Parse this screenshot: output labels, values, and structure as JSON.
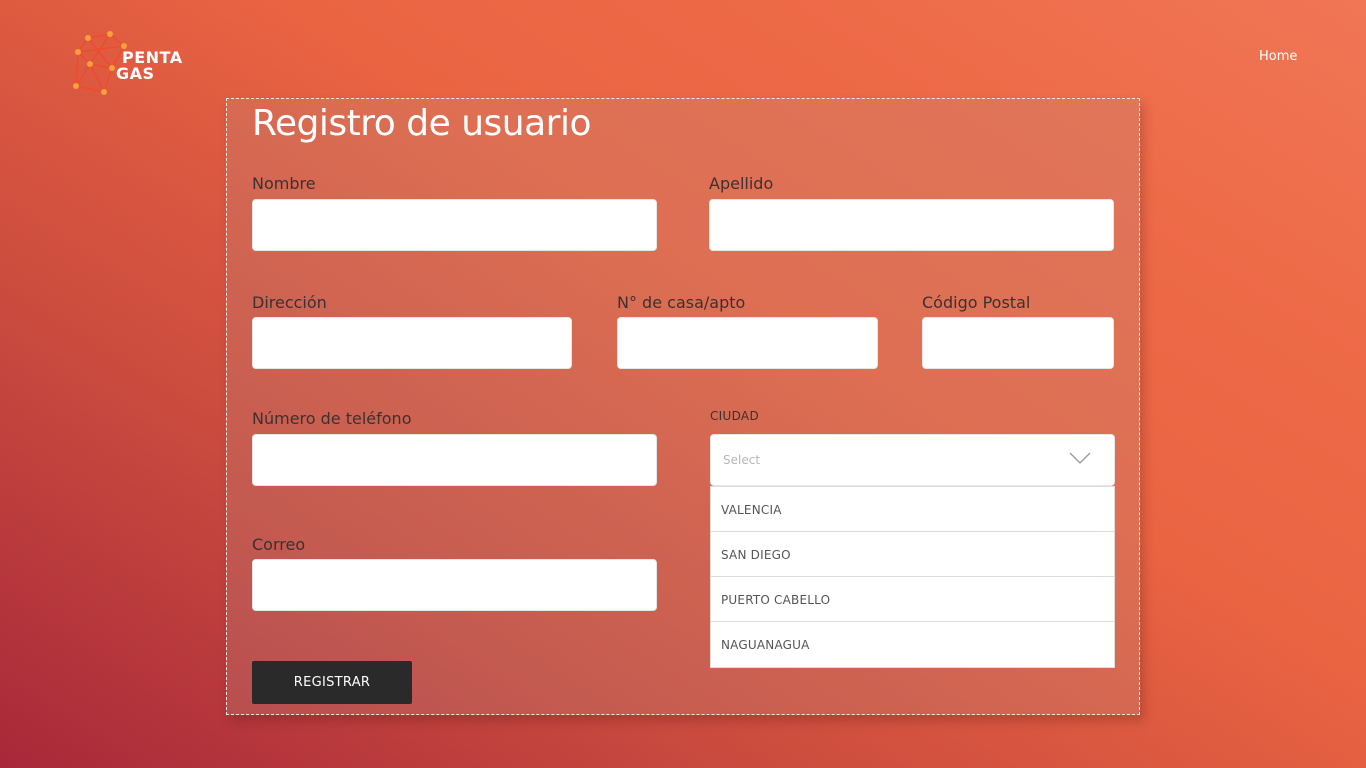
{
  "brand": {
    "line1": "PENTA",
    "line2": "GAS"
  },
  "nav": {
    "home": "Home"
  },
  "form": {
    "title": "Registro de usuario",
    "nombre_label": "Nombre",
    "apellido_label": "Apellido",
    "direccion_label": "Dirección",
    "casa_label": "N° de casa/apto",
    "postal_label": "Código Postal",
    "telefono_label": "Número de teléfono",
    "ciudad_label": "CIUDAD",
    "correo_label": "Correo",
    "ciudad_placeholder": "Select",
    "ciudad_options": [
      "VALENCIA",
      "SAN DIEGO",
      "PUERTO CABELLO",
      "NAGUANAGUA"
    ],
    "submit_label": "REGISTRAR"
  }
}
